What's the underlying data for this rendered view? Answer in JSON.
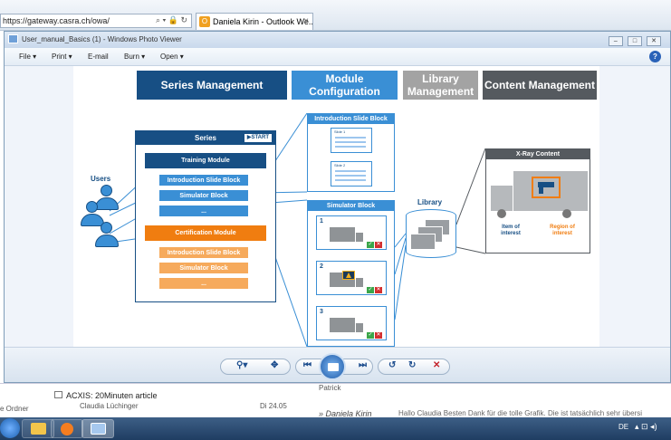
{
  "browser": {
    "address": "https://gateway.casra.ch/owa/",
    "address_icons": "⌕ ▾ 🔒 ↻",
    "tab_title": "Daniela Kirin - Outlook We...",
    "tab_icon_letter": "O",
    "tab_close": "×"
  },
  "background": {
    "mail_title": "ACXIS: 20Minuten article",
    "mail_sender": "Claudia Lüchinger",
    "mail_date": "Di 24.05",
    "left_folder_text": "e Ordner",
    "reading_name": "Patrick",
    "reading_sender": "» Daniela Kirin",
    "reading_preview": "Hallo Claudia Besten Dank für die tolle Grafik. Die ist tatsächlich sehr übersi"
  },
  "viewer": {
    "title": "User_manual_Basics (1) - Windows Photo Viewer",
    "menu": [
      "File",
      "Print",
      "E-mail",
      "Burn",
      "Open"
    ],
    "help": "?",
    "window_buttons": [
      "–",
      "□",
      "✕"
    ]
  },
  "slide": {
    "headers": {
      "series": "Series Management",
      "module": "Module Configuration",
      "library": "Library Management",
      "content": "Content Management"
    },
    "users_label": "Users",
    "series_title": "Series",
    "start_tag": "▶START",
    "training_module": "Training Module",
    "intro_block": "Introduction Slide Block",
    "simulator_block": "Simulator Block",
    "ellipsis": "...",
    "certification_module": "Certification Module",
    "intro_panel_title": "Introduction Slide Block",
    "mini_slide_1": "Slide 1",
    "mini_slide_2": "Slide 2",
    "sim_panel_title": "Simulator Block",
    "sim_numbers": [
      "1",
      "2",
      "3"
    ],
    "check_ok": "✓",
    "check_no": "✕",
    "library_label": "Library",
    "xray_title": "X-Ray Content",
    "item_of_interest": "Item of interest",
    "region_of_interest": "Region of interest"
  },
  "toolbar": {
    "zoom": "⚲▾",
    "fit": "✥",
    "prev": "⏮",
    "next": "⏭",
    "rotate_ccw": "↺",
    "rotate_cw": "↻",
    "delete": "✕"
  },
  "taskbar": {
    "language": "DE",
    "tray": "▴ ⊡ ◂)"
  }
}
